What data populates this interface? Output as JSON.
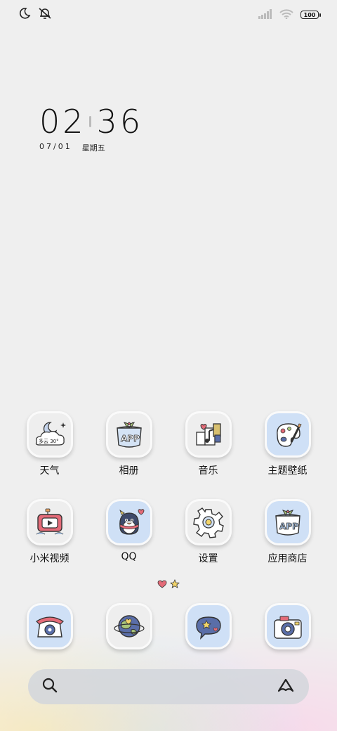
{
  "status": {
    "battery": "100"
  },
  "clock": {
    "hours": "02",
    "minutes": "36",
    "date": "07/01",
    "weekday": "星期五"
  },
  "weather_widget": {
    "text": "多云 30°"
  },
  "apps_row1": [
    {
      "label": "天气",
      "icon": "weather-icon"
    },
    {
      "label": "相册",
      "icon": "gallery-icon"
    },
    {
      "label": "音乐",
      "icon": "music-icon"
    },
    {
      "label": "主题壁纸",
      "icon": "themes-icon"
    }
  ],
  "apps_row2": [
    {
      "label": "小米视频",
      "icon": "video-icon"
    },
    {
      "label": "QQ",
      "icon": "qq-penguin-icon"
    },
    {
      "label": "设置",
      "icon": "settings-gear-icon"
    },
    {
      "label": "应用商店",
      "icon": "app-store-icon"
    }
  ],
  "dock": [
    {
      "label": "",
      "icon": "phone-icon"
    },
    {
      "label": "",
      "icon": "browser-globe-icon"
    },
    {
      "label": "",
      "icon": "messages-icon"
    },
    {
      "label": "",
      "icon": "camera-icon"
    }
  ],
  "colors": {
    "background": "#efefef",
    "tile_blue": "#cfe0f6",
    "heart": "#e46b78",
    "star": "#f3d56a"
  }
}
